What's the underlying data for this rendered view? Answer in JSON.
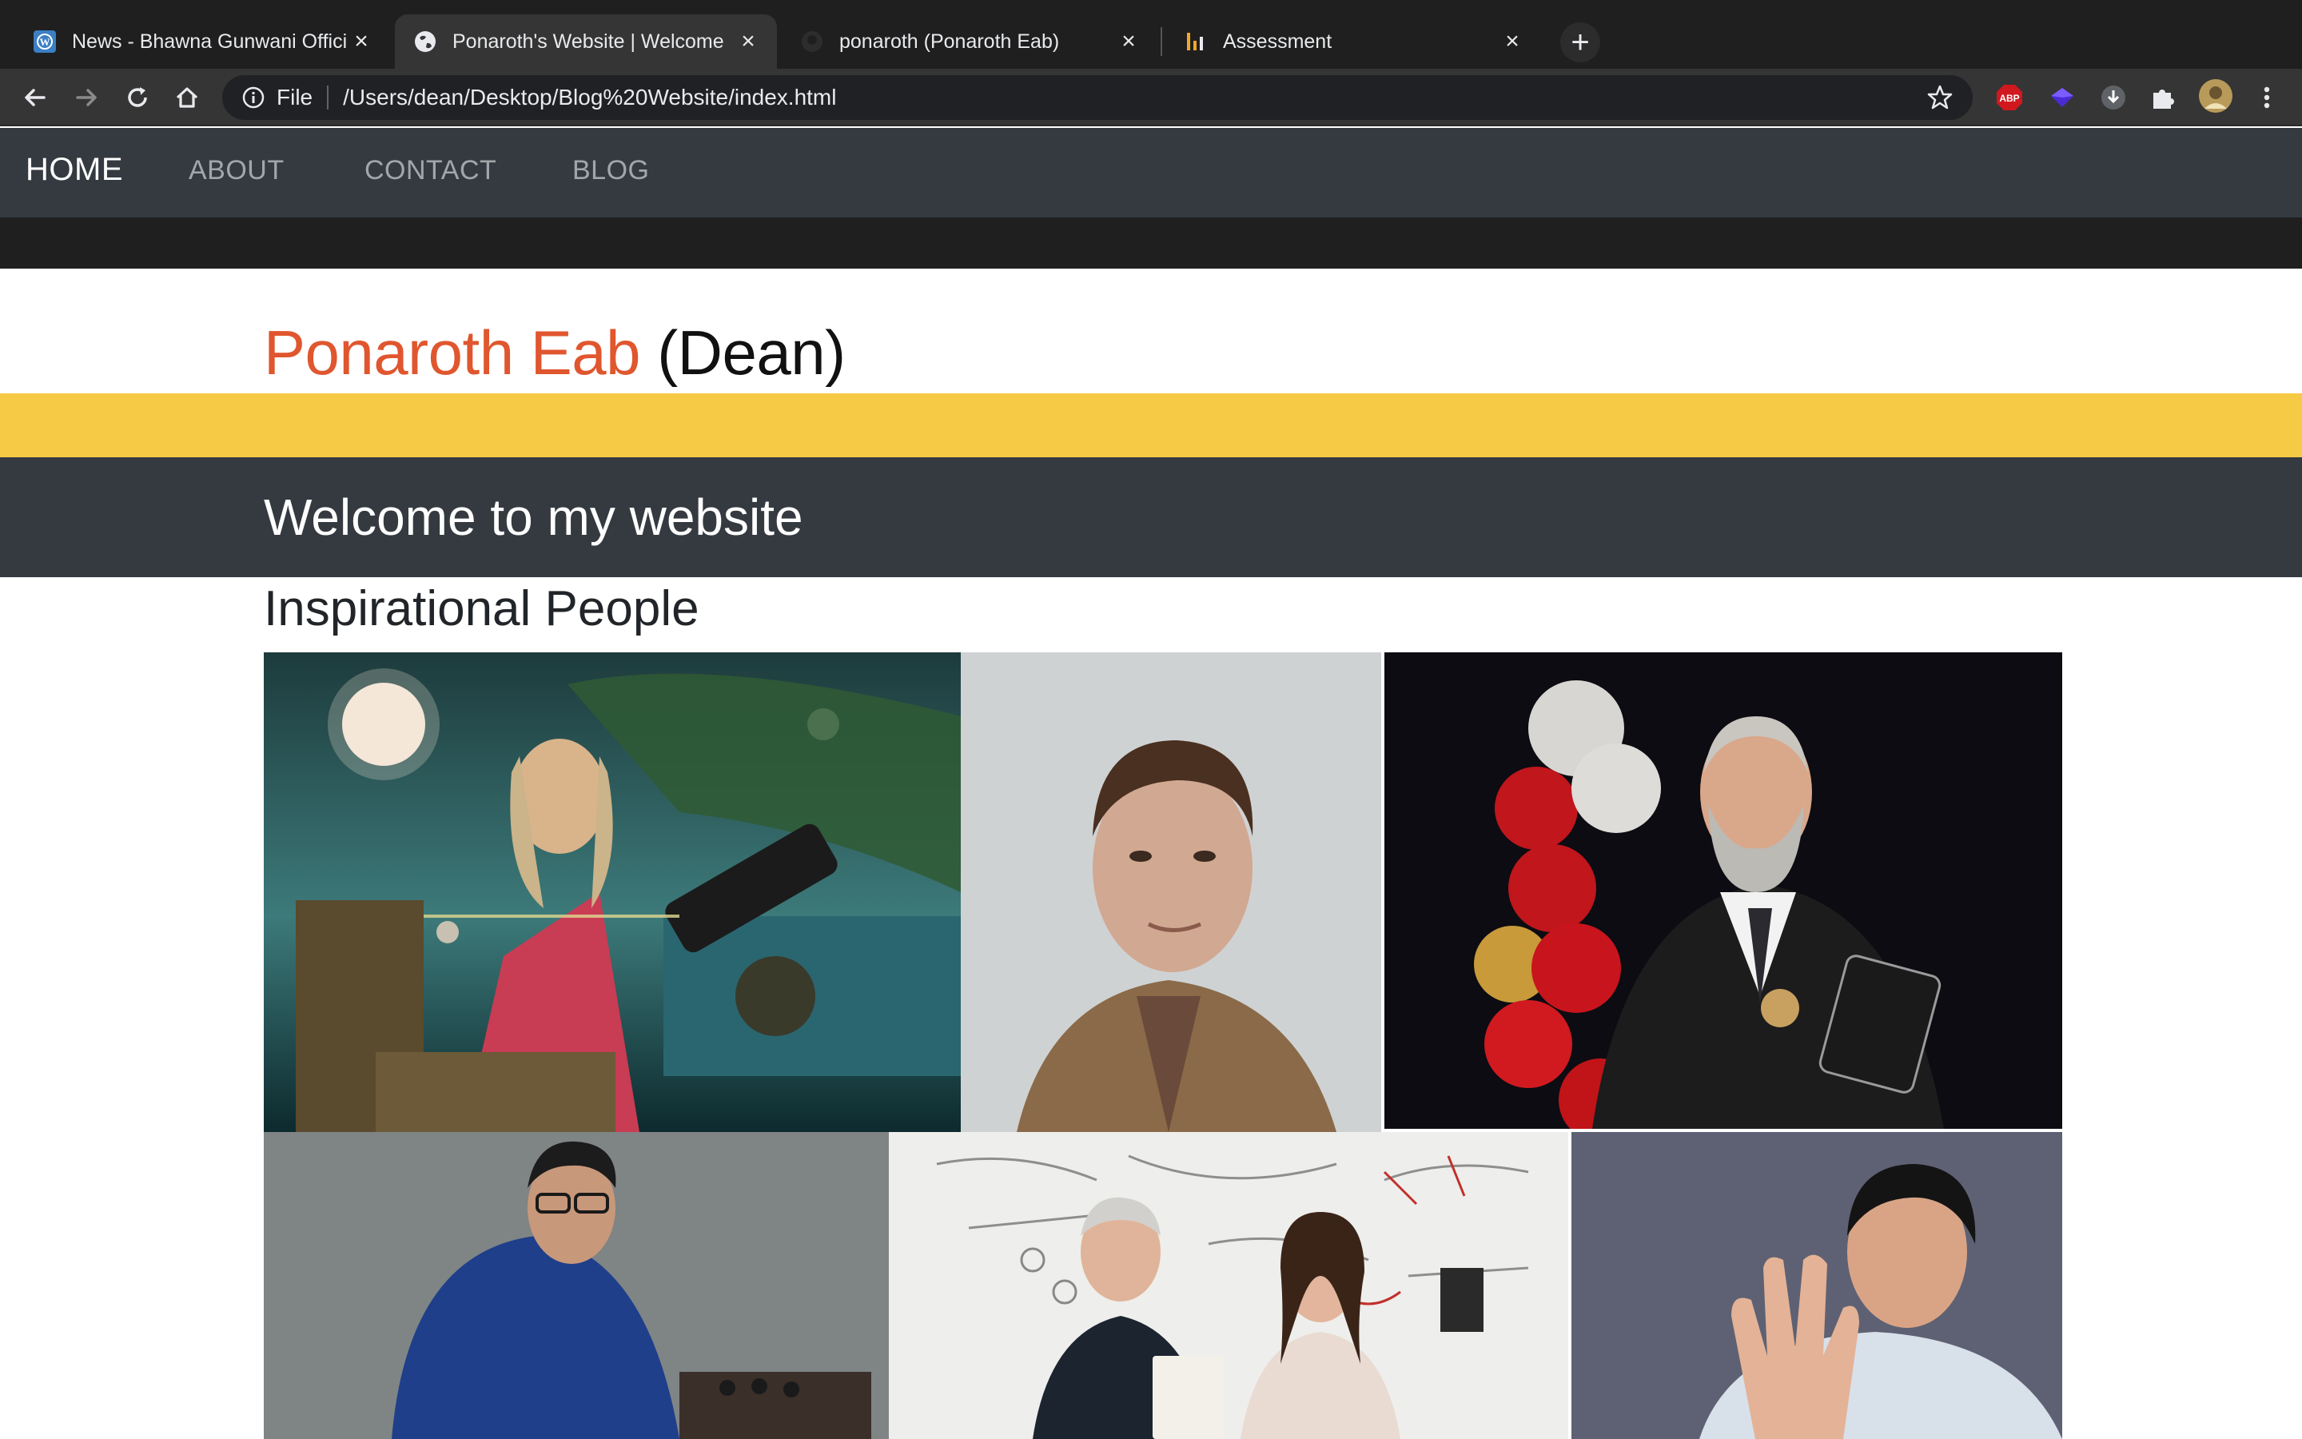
{
  "browser": {
    "tabs": [
      {
        "title": "News - Bhawna Gunwani Offici",
        "favicon": "wordpress-icon",
        "active": false
      },
      {
        "title": "Ponaroth's Website | Welcome",
        "favicon": "globe-icon",
        "active": true
      },
      {
        "title": "ponaroth (Ponaroth Eab)",
        "favicon": "github-icon",
        "active": false
      },
      {
        "title": "Assessment",
        "favicon": "analytics-icon",
        "active": false
      }
    ],
    "close_glyph": "×",
    "new_tab_glyph": "+",
    "address": {
      "scheme_label": "File",
      "url": "/Users/dean/Desktop/Blog%20Website/index.html"
    },
    "extensions": [
      "abp-icon",
      "diamond-extension-icon",
      "download-extension-icon",
      "puzzle-icon",
      "profile-avatar"
    ]
  },
  "site": {
    "nav": [
      {
        "label": "HOME",
        "active": true
      },
      {
        "label": "ABOUT",
        "active": false
      },
      {
        "label": "CONTACT",
        "active": false
      },
      {
        "label": "BLOG",
        "active": false
      }
    ],
    "brand": {
      "name": "Ponaroth Eab",
      "nickname": "(Dean)"
    },
    "welcome": "Welcome to my website",
    "section_title": "Inspirational People"
  },
  "colors": {
    "nav_bg": "#343a40",
    "brand_accent": "#e0562e",
    "yellow_band": "#f7ca46"
  }
}
